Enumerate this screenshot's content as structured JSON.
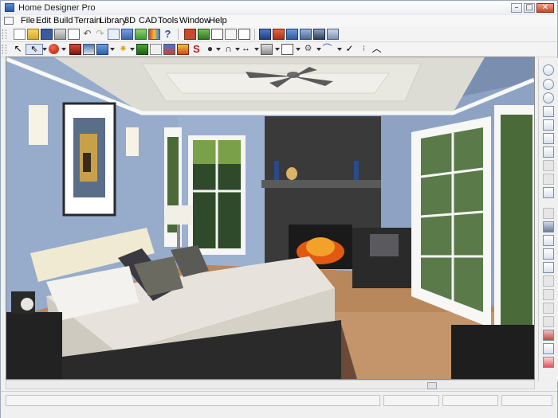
{
  "window": {
    "title": "Home Designer Pro",
    "controls": {
      "minimize": "–",
      "maximize": "□",
      "close": "✕"
    }
  },
  "menu": [
    "File",
    "Edit",
    "Build",
    "Terrain",
    "Library",
    "3D",
    "CAD",
    "Tools",
    "Window",
    "Help"
  ],
  "toolbar_top": {
    "icons": [
      "new-file-icon",
      "open-folder-icon",
      "save-icon",
      "print-icon",
      "print-preview-icon",
      "undo-icon",
      "redo-icon",
      "select-objects-icon",
      "library-browser-icon",
      "material-icon",
      "color-icon",
      "help-icon",
      "floor-plan-view-icon",
      "elevation-view-icon",
      "cross-section-icon",
      "framing-overview-icon",
      "camera-view-icon",
      "perspective-full-overview-icon",
      "dollhouse-view-icon",
      "glass-house-view-icon",
      "watercolor-view-icon",
      "technical-illustration-icon",
      "vector-view-icon"
    ]
  },
  "toolbar_bottom": {
    "icons": [
      "select-arrow-icon",
      "edit-tool-icon",
      "object-tool-icon",
      "camera-tool-icon",
      "fixture-tool-icon",
      "texture-tool-icon",
      "light-tool-icon",
      "terrain-tool-icon",
      "paint-tool-icon",
      "dimension-tool-icon",
      "spray-tool-icon",
      "text-tool-icon",
      "line-tool-icon",
      "door-tool-icon",
      "cabinet-tool-icon",
      "window-tool-icon",
      "stair-tool-icon",
      "roof-tool-icon",
      "arc-tool-icon",
      "check-tool-icon"
    ]
  },
  "side_toolbar": {
    "icons": [
      "zoom-rotate-icon",
      "zoom-in-icon",
      "zoom-out-icon",
      "fill-window-icon",
      "zoom-window-icon",
      "undo-zoom-icon",
      "pan-icon",
      "orbit-icon",
      "walk-icon",
      "camera-height-icon",
      "reference-icon",
      "dimension-icon",
      "distance-icon",
      "snap-icon",
      "grid-icon",
      "layer-icon",
      "material-eyedropper-icon",
      "plant-icon",
      "terrain-icon",
      "render-icon",
      "display-options-icon",
      "toggle-icon"
    ]
  },
  "colors": {
    "wall": "#8ea3c4",
    "ceiling": "#d8d8d0",
    "trim": "#f4f4f2",
    "floor": "#b5845a",
    "stone": "#3a3a3a",
    "fire": "#e25a12",
    "bedding": "#e9e6df"
  },
  "scene": {
    "description_icon": "bedroom-3d-render"
  }
}
